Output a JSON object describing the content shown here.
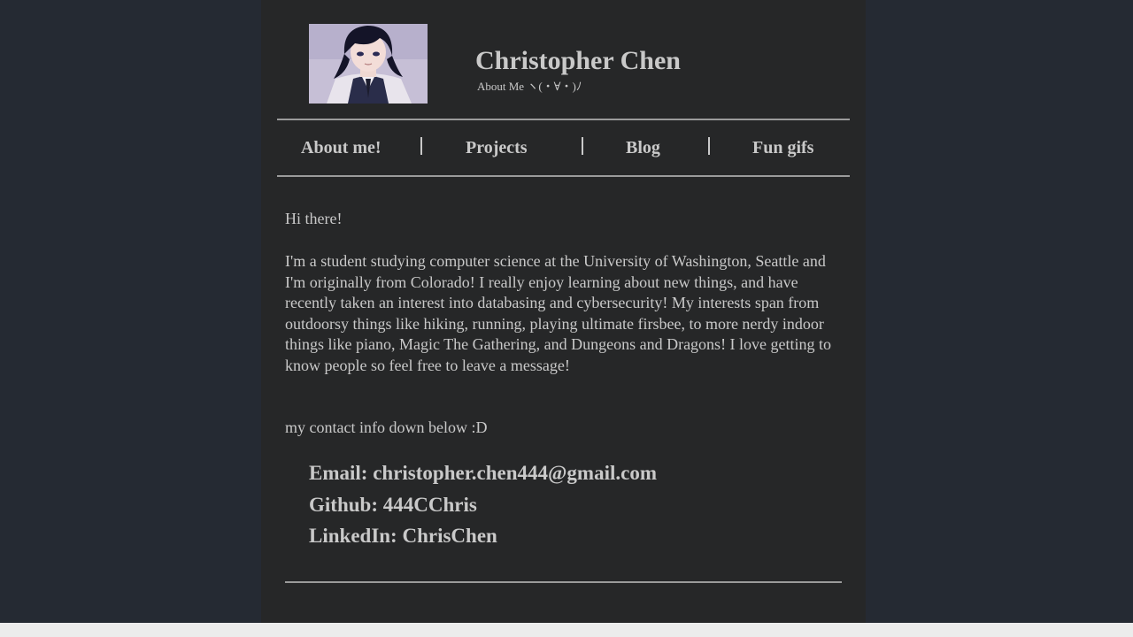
{
  "header": {
    "name": "Christopher Chen",
    "subtitle": "About Me ヽ(・∀・)ﾉ"
  },
  "nav": {
    "items": [
      {
        "label": "About me!"
      },
      {
        "label": "Projects"
      },
      {
        "label": "Blog"
      },
      {
        "label": "Fun gifs"
      }
    ]
  },
  "content": {
    "greeting": "Hi there!",
    "intro": "I'm a student studying computer science at the University of Washington, Seattle and I'm originally from Colorado! I really enjoy learning about new things, and have recently taken an interest into databasing and cybersecurity! My interests span from outdoorsy things like hiking, running, playing ultimate firsbee, to more nerdy indoor things like piano, Magic The Gathering, and Dungeons and Dragons! I love getting to know people so feel free to leave a message!",
    "contact_note": "my contact info down below :D"
  },
  "contact": {
    "email": "Email: christopher.chen444@gmail.com",
    "github": "Github: 444CChris",
    "linkedin": "LinkedIn: ChrisChen"
  },
  "colors": {
    "outer_background": "#252a33",
    "page_background": "#262728",
    "text": "#c9c9c9",
    "rule": "#9b9b9b"
  },
  "icons": {
    "avatar": "profile-portrait"
  }
}
